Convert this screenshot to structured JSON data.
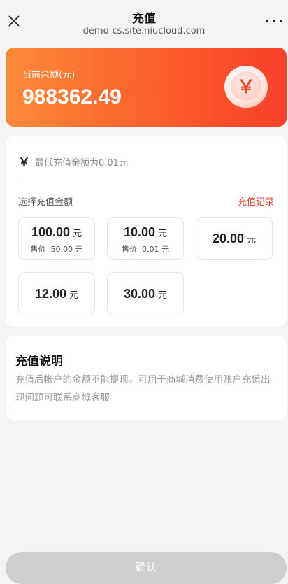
{
  "nav": {
    "title": "充值",
    "url": "demo-cs.site.niucloud.com"
  },
  "balance": {
    "label": "当前余额(元)",
    "amount": "988362.49",
    "coin_symbol": "￥"
  },
  "recharge": {
    "currency_symbol": "￥",
    "input_placeholder": "最低充值金额为0.01元",
    "select_label": "选择充值金额",
    "record_link": "充值记录",
    "options": [
      {
        "amount": "100.00",
        "unit": "元",
        "price_label": "售价",
        "price": "50.00 元"
      },
      {
        "amount": "10.00",
        "unit": "元",
        "price_label": "售价",
        "price": "0.01 元"
      },
      {
        "amount": "20.00",
        "unit": "元"
      },
      {
        "amount": "12.00",
        "unit": "元"
      },
      {
        "amount": "30.00",
        "unit": "元"
      }
    ]
  },
  "explain": {
    "title": "充值说明",
    "text": "充值后帐户的金额不能提现，可用于商城消费使用账户充值出现问题可联系商城客服"
  },
  "footer": {
    "confirm_label": "确认"
  },
  "colors": {
    "accent": "#fb5a2a",
    "link": "#e43d30",
    "confirm_disabled": "#cfcfcf"
  }
}
